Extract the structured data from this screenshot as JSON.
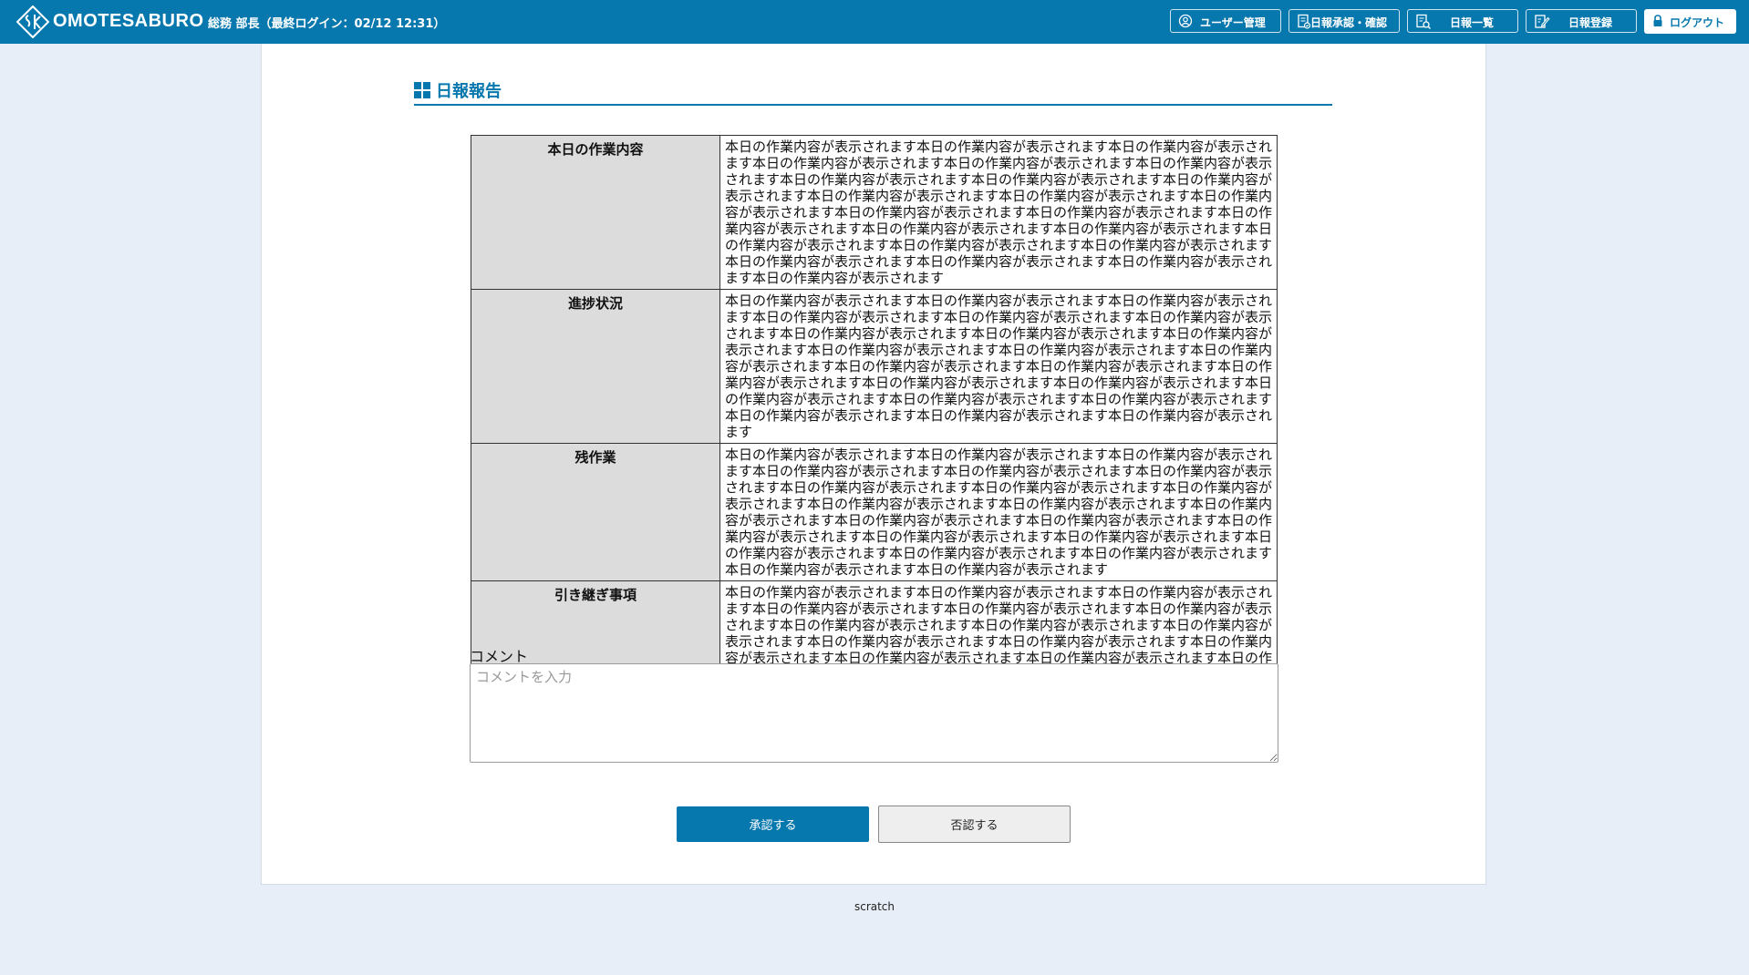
{
  "header": {
    "brand": "OMOTESABURO",
    "user_info": "総務 部長（最終ログイン：02/12 12:31）",
    "nav": [
      {
        "label": "ユーザー管理",
        "icon": "user-circle-icon"
      },
      {
        "label": "日報承認・確認",
        "icon": "document-check-icon"
      },
      {
        "label": "日報一覧",
        "icon": "document-search-icon"
      },
      {
        "label": "日報登録",
        "icon": "edit-document-icon"
      }
    ],
    "logout_label": "ログアウト",
    "logout_icon": "lock-icon",
    "colors": {
      "primary": "#0778ae",
      "background": "#e7eef7"
    }
  },
  "section": {
    "title": "日報報告",
    "icon": "grid-icon"
  },
  "report": {
    "rows": [
      {
        "label": "本日の作業内容",
        "value": "本日の作業内容が表示されます本日の作業内容が表示されます本日の作業内容が表示されます本日の作業内容が表示されます本日の作業内容が表示されます本日の作業内容が表示されます本日の作業内容が表示されます本日の作業内容が表示されます本日の作業内容が表示されます本日の作業内容が表示されます本日の作業内容が表示されます本日の作業内容が表示されます本日の作業内容が表示されます本日の作業内容が表示されます本日の作業内容が表示されます本日の作業内容が表示されます本日の作業内容が表示されます本日の作業内容が表示されます本日の作業内容が表示されます本日の作業内容が表示されます本日の作業内容が表示されます本日の作業内容が表示されます本日の作業内容が表示されます本日の作業内容が表示されます"
      },
      {
        "label": "進捗状況",
        "value": "本日の作業内容が表示されます本日の作業内容が表示されます本日の作業内容が表示されます本日の作業内容が表示されます本日の作業内容が表示されます本日の作業内容が表示されます本日の作業内容が表示されます本日の作業内容が表示されます本日の作業内容が表示されます本日の作業内容が表示されます本日の作業内容が表示されます本日の作業内容が表示されます本日の作業内容が表示されます本日の作業内容が表示されます本日の作業内容が表示されます本日の作業内容が表示されます本日の作業内容が表示されます本日の作業内容が表示されます本日の作業内容が表示されます本日の作業内容が表示されます本日の作業内容が表示されます本日の作業内容が表示されます本日の作業内容が表示されます"
      },
      {
        "label": "残作業",
        "value": "本日の作業内容が表示されます本日の作業内容が表示されます本日の作業内容が表示されます本日の作業内容が表示されます本日の作業内容が表示されます本日の作業内容が表示されます本日の作業内容が表示されます本日の作業内容が表示されます本日の作業内容が表示されます本日の作業内容が表示されます本日の作業内容が表示されます本日の作業内容が表示されます本日の作業内容が表示されます本日の作業内容が表示されます本日の作業内容が表示されます本日の作業内容が表示されます本日の作業内容が表示されます本日の作業内容が表示されます本日の作業内容が表示されます本日の作業内容が表示されます本日の作業内容が表示されます本日の作業内容が表示されます"
      },
      {
        "label": "引き継ぎ事項",
        "value": "本日の作業内容が表示されます本日の作業内容が表示されます本日の作業内容が表示されます本日の作業内容が表示されます本日の作業内容が表示されます本日の作業内容が表示されます本日の作業内容が表示されます本日の作業内容が表示されます本日の作業内容が表示されます本日の作業内容が表示されます本日の作業内容が表示されます本日の作業内容が表示されます本日の作業内容が表示されます本日の作業内容が表示されます本日の作業内容が表示されます本日の作業内容が表示されます本日の作業内容が表示されます本日の作業内容が表示されます本日の作業内容が表示されます"
      }
    ]
  },
  "comment": {
    "label": "コメント",
    "placeholder": "コメントを入力",
    "value": ""
  },
  "actions": {
    "approve_label": "承認する",
    "reject_label": "否認する"
  },
  "footer": {
    "text": "scratch"
  }
}
